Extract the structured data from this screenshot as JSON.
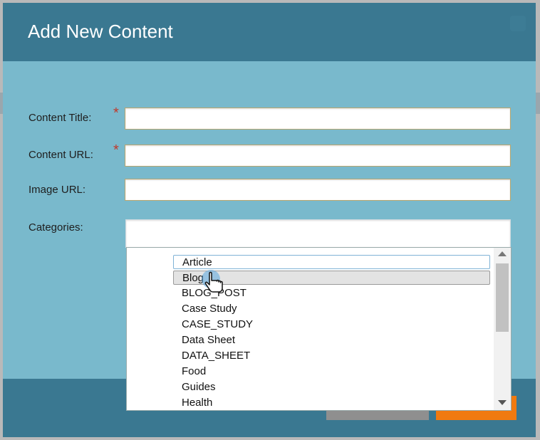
{
  "modal": {
    "title": "Add New Content"
  },
  "form": {
    "content_title_label": "Content Title:",
    "content_url_label": "Content URL:",
    "image_url_label": "Image URL:",
    "categories_label": "Categories:",
    "required_mark": "*",
    "content_title_value": "",
    "content_url_value": "",
    "image_url_value": ""
  },
  "categories_dropdown": {
    "options": [
      "Article",
      "Blog",
      "BLOG_POST",
      "Case Study",
      "CASE_STUDY",
      "Data Sheet",
      "DATA_SHEET",
      "Food",
      "Guides",
      "Health"
    ],
    "focused": "Article",
    "hovered": "Blog"
  },
  "colors": {
    "header": "#3a7891",
    "body": "#79b9cc",
    "save_button": "#f07a10",
    "cancel_button": "#8f8f8f",
    "required": "#c0392b"
  },
  "icons": [
    "close-icon",
    "hand-pointer-icon",
    "scroll-up-arrow-icon",
    "scroll-down-arrow-icon"
  ]
}
